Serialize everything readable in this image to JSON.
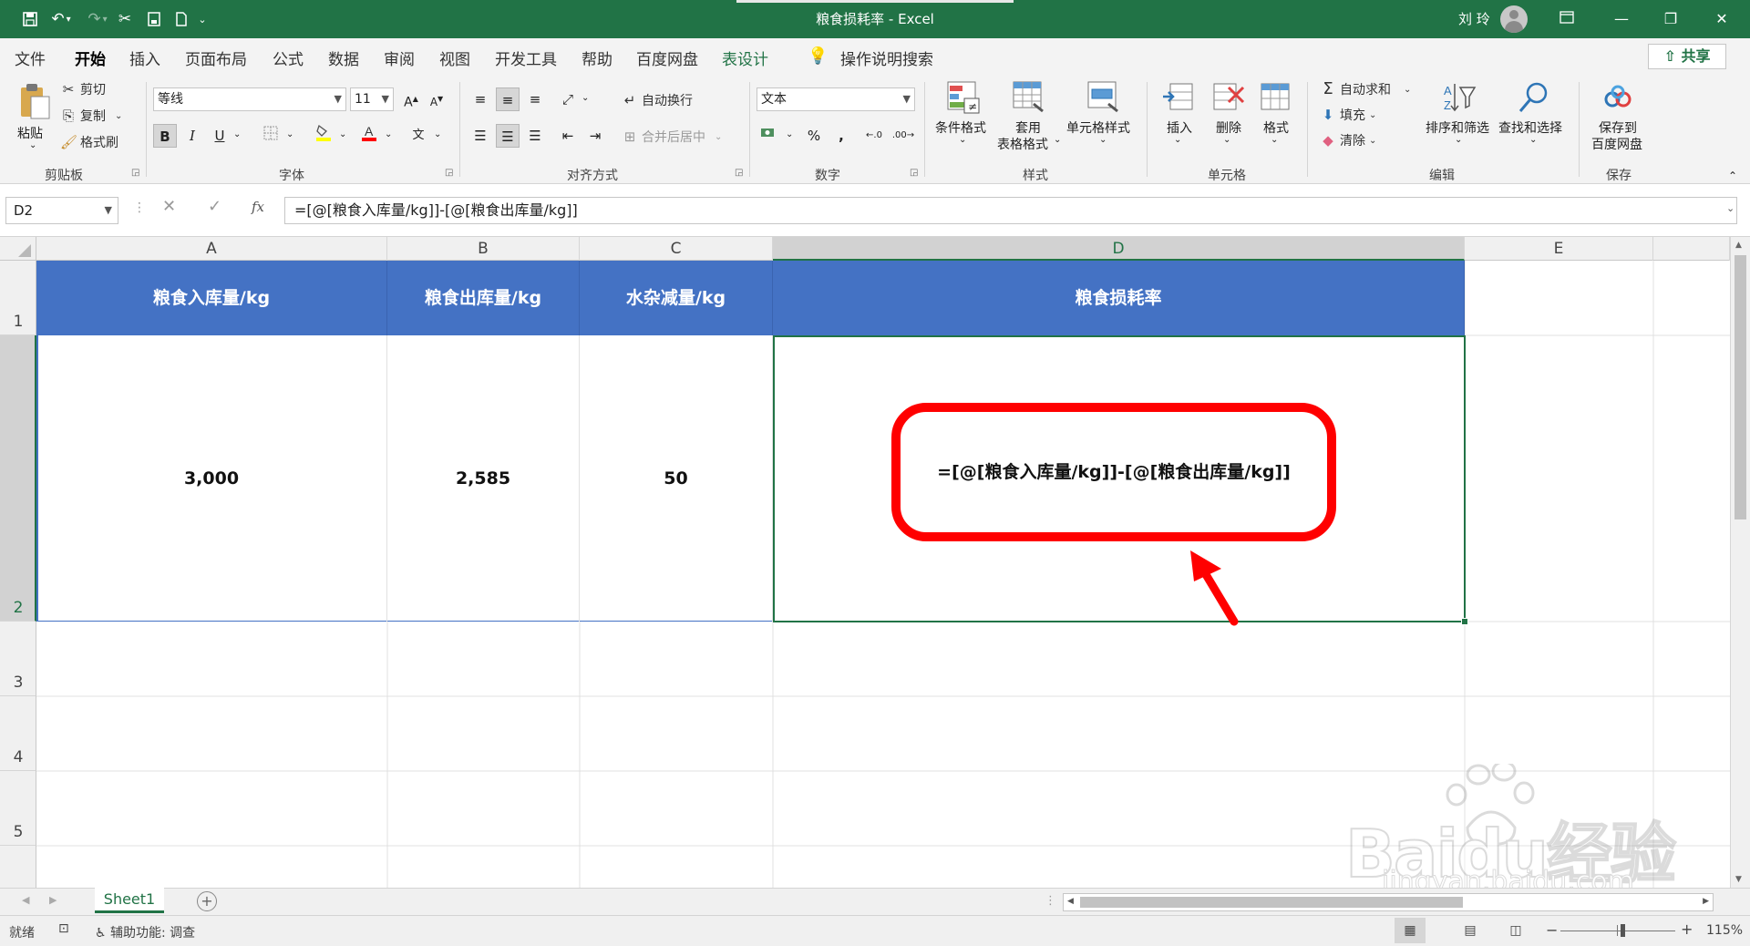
{
  "window": {
    "title": "粮食损耗率 - Excel",
    "user": "刘 玲"
  },
  "ribbon_tabs": [
    "文件",
    "开始",
    "插入",
    "页面布局",
    "公式",
    "数据",
    "审阅",
    "视图",
    "开发工具",
    "帮助",
    "百度网盘",
    "表设计"
  ],
  "tell_me": "操作说明搜索",
  "share_label": "共享",
  "clipboard": {
    "paste": "粘贴",
    "cut": "剪切",
    "copy": "复制",
    "format_painter": "格式刷",
    "group": "剪贴板"
  },
  "font": {
    "name": "等线",
    "size": "11",
    "group": "字体",
    "grow": "A",
    "shrink": "A",
    "bold": "B",
    "italic": "I",
    "underline": "U",
    "phonetic": "文"
  },
  "alignment": {
    "wrap": "自动换行",
    "merge": "合并后居中",
    "group": "对齐方式"
  },
  "number": {
    "format": "文本",
    "percent": "%",
    "comma": ",",
    "group": "数字"
  },
  "styles": {
    "conditional": "条件格式",
    "table_l1": "套用",
    "table_l2": "表格格式",
    "cell_styles": "单元格样式",
    "group": "样式"
  },
  "cells": {
    "insert": "插入",
    "delete": "删除",
    "format": "格式",
    "group": "单元格"
  },
  "editing": {
    "autosum": "自动求和",
    "fill": "填充",
    "clear": "清除",
    "sort": "排序和筛选",
    "find": "查找和选择",
    "group": "编辑"
  },
  "save": {
    "label_l1": "保存到",
    "label_l2": "百度网盘",
    "group": "保存"
  },
  "formula_bar": {
    "name_box": "D2",
    "fx": "fx",
    "formula": "=[@[粮食入库量/kg]]-[@[粮食出库量/kg]]"
  },
  "columns": [
    "A",
    "B",
    "C",
    "D",
    "E"
  ],
  "rows": [
    "1",
    "2",
    "3",
    "4",
    "5"
  ],
  "table": {
    "headers": [
      "粮食入库量/kg",
      "粮食出库量/kg",
      "水杂减量/kg",
      "粮食损耗率"
    ],
    "row1": [
      "3,000",
      "2,585",
      "50",
      "=[@[粮食入库量/kg]]-[@[粮食出库量/kg]]"
    ]
  },
  "sheet_tabs": [
    "Sheet1"
  ],
  "status": {
    "ready": "就绪",
    "accessibility": "辅助功能: 调查",
    "zoom": "115%"
  },
  "watermark": {
    "line1": "Baidu经验",
    "line2": "jingyan.baidu.com"
  },
  "colors": {
    "excel_green": "#217346",
    "table_header": "#4472c4",
    "callout": "#ff0000"
  }
}
